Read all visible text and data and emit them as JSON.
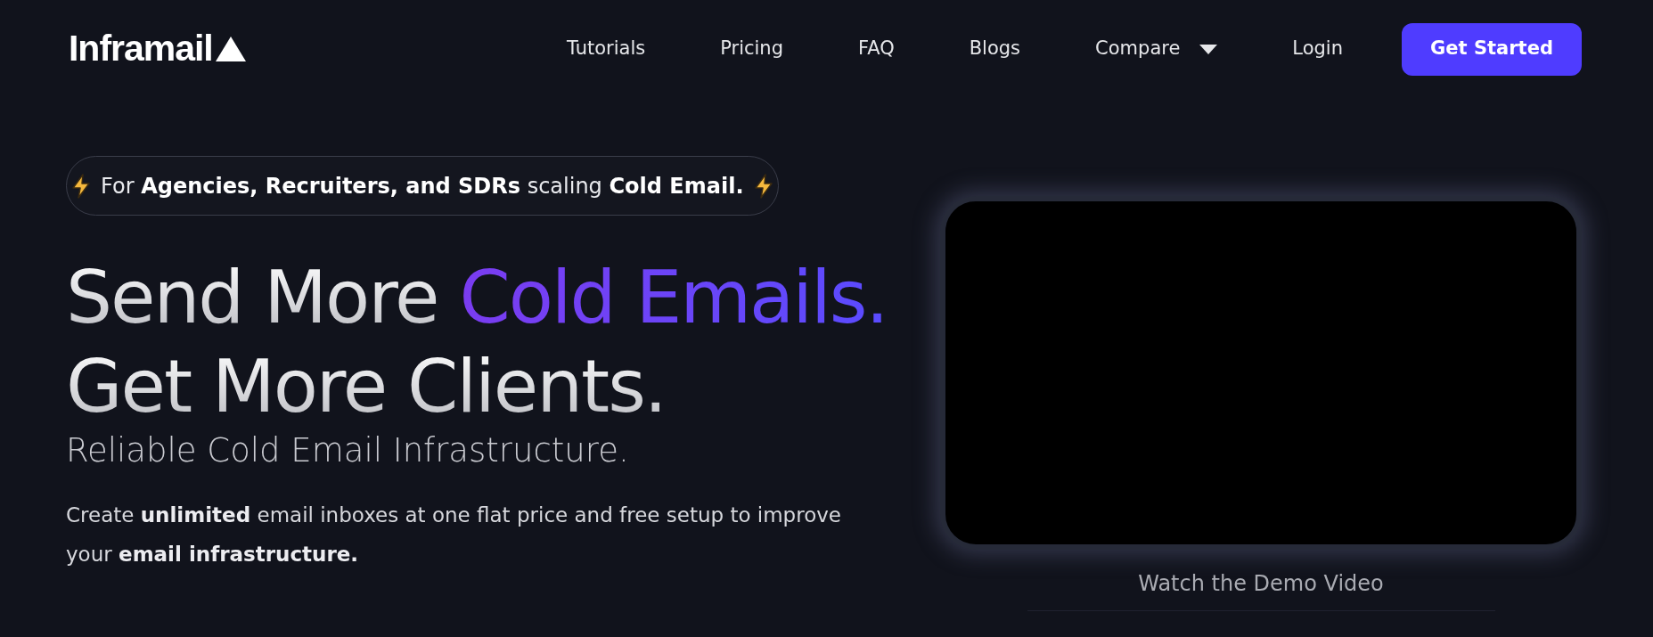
{
  "header": {
    "logo": "Inframail",
    "nav": [
      {
        "label": "Tutorials",
        "kind": "link"
      },
      {
        "label": "Pricing",
        "kind": "link"
      },
      {
        "label": "FAQ",
        "kind": "link"
      },
      {
        "label": "Blogs",
        "kind": "link"
      },
      {
        "label": "Compare",
        "kind": "dropdown"
      },
      {
        "label": "Login",
        "kind": "link"
      }
    ],
    "cta": "Get Started"
  },
  "hero": {
    "badge": "For **Agencies, Recruiters, and SDRs** scaling **Cold Email.**",
    "headline": [
      {
        "text": "Send More",
        "accent": false
      },
      {
        "text": "Cold Emails.",
        "accent": true
      }
    ],
    "headline_line2": "Get More Clients.",
    "subtitle": "Reliable Cold Email Infrastructure.",
    "description": "Create **unlimited** email inboxes at one flat price and free setup to improve your **email infrastructure.**",
    "video_caption": "Watch the Demo Video"
  }
}
